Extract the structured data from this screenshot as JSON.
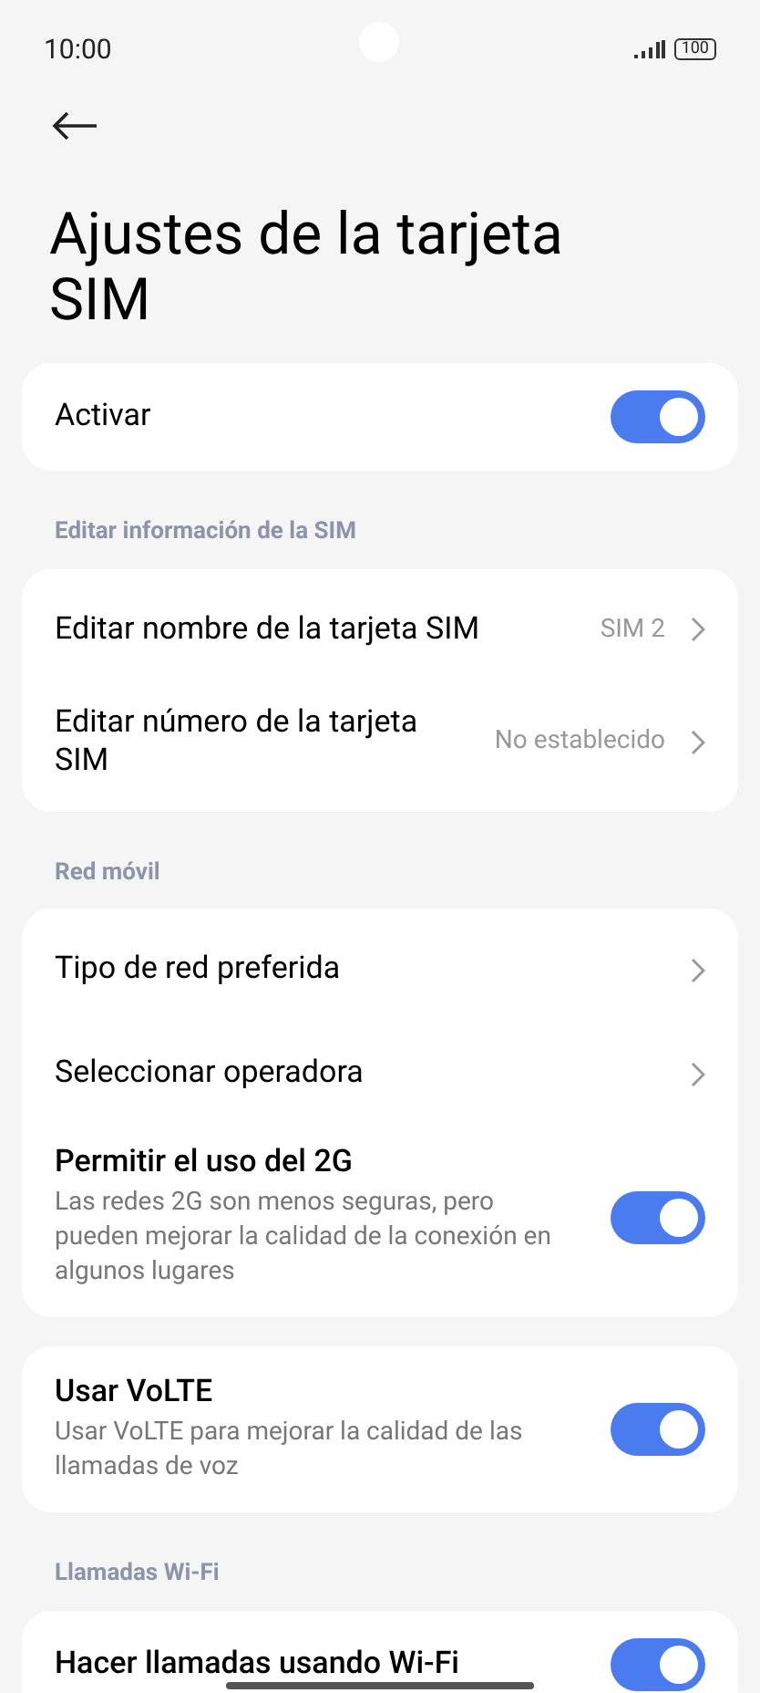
{
  "status_bar": {
    "time": "10:00",
    "battery": "100"
  },
  "title": "Ajustes de la tarjeta SIM",
  "sections": [
    {
      "cards": [
        {
          "rows": [
            {
              "kind": "toggle",
              "label": "Activar",
              "on": true
            }
          ]
        }
      ]
    },
    {
      "header": "Editar información de la SIM",
      "cards": [
        {
          "rows": [
            {
              "kind": "link",
              "label": "Editar nombre de la tarjeta SIM",
              "value": "SIM 2"
            },
            {
              "kind": "link",
              "label": "Editar número de la tarjeta SIM",
              "value": "No establecido"
            }
          ]
        }
      ]
    },
    {
      "header": "Red móvil",
      "cards": [
        {
          "rows": [
            {
              "kind": "link",
              "label": "Tipo de red preferida"
            },
            {
              "kind": "link",
              "label": "Seleccionar operadora"
            },
            {
              "kind": "toggle",
              "label": "Permitir el uso del 2G",
              "description": "Las redes 2G son menos seguras, pero pueden mejorar la calidad de la conexión en algunos lugares",
              "on": true
            }
          ]
        },
        {
          "rows": [
            {
              "kind": "toggle",
              "label": "Usar VoLTE",
              "description": "Usar VoLTE para mejorar la calidad de las llamadas de voz",
              "on": true
            }
          ]
        }
      ]
    },
    {
      "header": "Llamadas Wi-Fi",
      "cards": [
        {
          "rows": [
            {
              "kind": "toggle",
              "label": "Hacer llamadas usando Wi-Fi",
              "on": true
            }
          ]
        }
      ]
    }
  ]
}
